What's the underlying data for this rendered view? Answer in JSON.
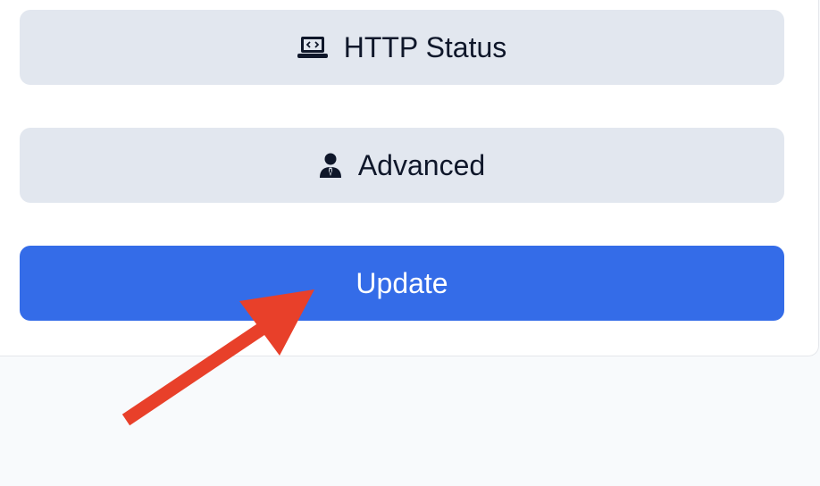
{
  "buttons": {
    "http_status": {
      "label": "HTTP Status",
      "icon": "laptop-code-icon"
    },
    "advanced": {
      "label": "Advanced",
      "icon": "user-tie-icon"
    },
    "update": {
      "label": "Update"
    }
  },
  "annotation": {
    "arrow_color": "#e8402a",
    "points_to": "update-button"
  },
  "colors": {
    "primary": "#346ce8",
    "secondary_button": "#e2e7ef",
    "text_dark": "#0f172a",
    "page_background": "#f8fafc"
  }
}
